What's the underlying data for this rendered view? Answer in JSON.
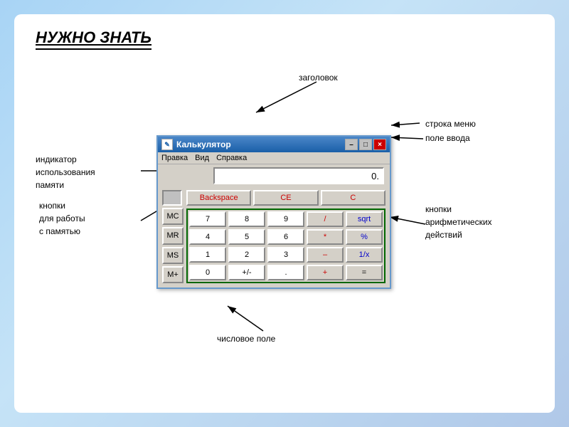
{
  "page": {
    "title": "НУЖНО ЗНАТЬ",
    "bg_color": "#b8d8f0"
  },
  "annotations": {
    "zagolovok": "заголовок",
    "stroka_menu": "строка меню",
    "pole_vvoda": "поле ввода",
    "indikator": "индикатор\nиспользования\nпамяти",
    "knopki_pamyat": "кнопки\nдля работы\nс памятью",
    "chislovoe_pole": "числовое поле",
    "knopki_arifm": "кнопки\nарифметических\nдействий"
  },
  "calculator": {
    "title": "Калькулятор",
    "menu_items": [
      "Правка",
      "Вид",
      "Справка"
    ],
    "display_value": "0.",
    "titlebar_buttons": [
      "–",
      "□",
      "×"
    ],
    "memory_indicator": "",
    "memory_buttons": [
      "MC",
      "MR",
      "MS",
      "M+"
    ],
    "top_buttons": [
      "Backspace",
      "CE",
      "C"
    ],
    "number_buttons": [
      [
        "7",
        "8",
        "9",
        "/",
        "sqrt"
      ],
      [
        "4",
        "5",
        "6",
        "*",
        "%"
      ],
      [
        "1",
        "2",
        "3",
        "–",
        "1/x"
      ],
      [
        "0",
        "+/-",
        ".",
        "+",
        "="
      ]
    ]
  }
}
